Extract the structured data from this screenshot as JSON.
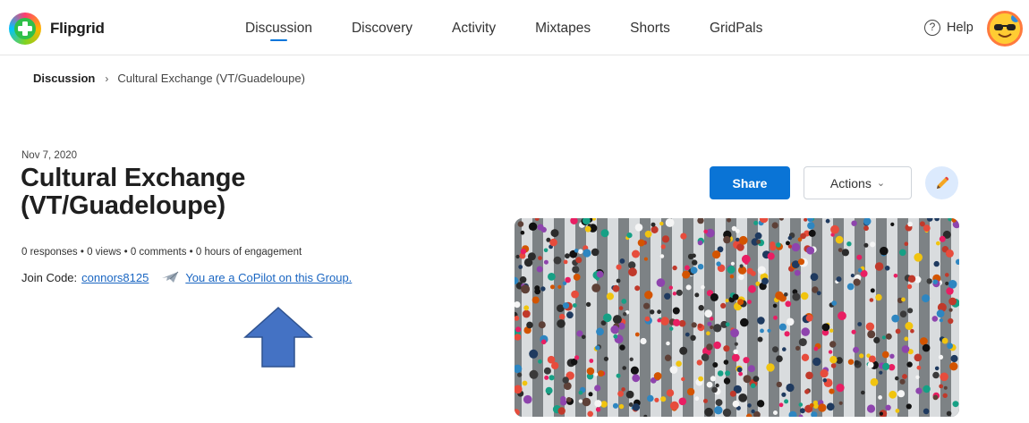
{
  "brand": {
    "name": "Flipgrid"
  },
  "nav": {
    "items": [
      {
        "label": "Discussion",
        "active": true
      },
      {
        "label": "Discovery",
        "active": false
      },
      {
        "label": "Activity",
        "active": false
      },
      {
        "label": "Mixtapes",
        "active": false
      },
      {
        "label": "Shorts",
        "active": false
      },
      {
        "label": "GridPals",
        "active": false
      }
    ],
    "help_label": "Help",
    "help_icon": "question-icon"
  },
  "breadcrumb": {
    "root": "Discussion",
    "separator": "›",
    "current": "Cultural Exchange (VT/Guadeloupe)"
  },
  "group": {
    "date": "Nov 7, 2020",
    "title": "Cultural Exchange (VT/Guadeloupe)",
    "stats": "0 responses • 0 views • 0 comments • 0 hours of engagement",
    "join_label": "Join Code:",
    "join_code": "connors8125",
    "copilot_text": "You are a CoPilot on this Group."
  },
  "actions": {
    "share_label": "Share",
    "actions_label": "Actions",
    "edit_icon": "pencil-icon"
  },
  "cover_image": {
    "icon": "crowd-crosswalk-photo"
  },
  "colors": {
    "accent": "#0a74d6",
    "link": "#1a66c2",
    "annotation_arrow": "#4472c4"
  }
}
